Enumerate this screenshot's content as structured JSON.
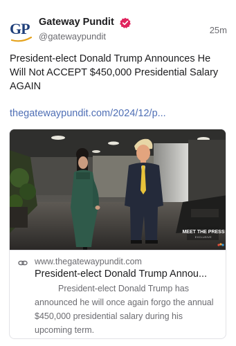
{
  "post": {
    "author_name": "Gateway Pundit",
    "avatar_text": "GP",
    "handle": "@gatewaypundit",
    "time": "25m",
    "text": "President-elect Donald Trump Announces He Will Not ACCEPT $450,000 Presidential Salary AGAIN",
    "link_text": "thegatewaypundit.com/2024/12/p..."
  },
  "card": {
    "domain": "www.thegatewaypundit.com",
    "title": "President-elect Donald Trump Annou...",
    "description": "President-elect Donald Trump has announced he will once again forgo the annual $450,000 presidential salary during his upcoming term.",
    "watermark_line1": "MEET THE PRESS",
    "watermark_line2": "EXCLUSIVE"
  },
  "colors": {
    "brand_blue": "#1f3f7a",
    "brand_gold": "#e5a21b",
    "verified_red": "#e0245e",
    "link_blue": "#4f6fb5",
    "secondary_text": "#6b6b70"
  },
  "icons": {
    "verified": "verified-badge-icon",
    "link": "link-chain-icon"
  }
}
